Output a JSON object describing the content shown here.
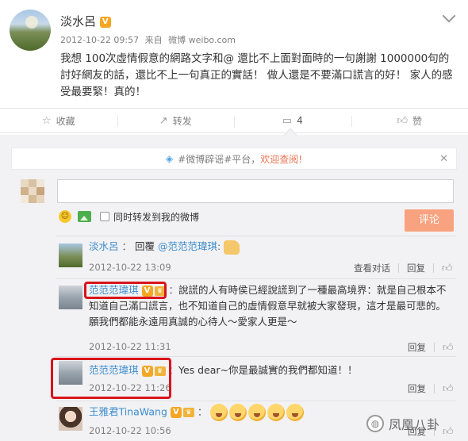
{
  "post": {
    "author": "淡水呂",
    "verified_badge": "V",
    "timestamp": "2012-10-22 09:57",
    "source_prefix": "来自",
    "source": "微博 weibo.com",
    "text": "我想 100次虛情假意的網路文字和@ 還比不上面對面時的一句謝謝 1000000句的討好網友的話，還比不上一句真正的實話！ 做人還是不要滿口謊言的好！ 家人的感受最要緊！真的！"
  },
  "actions": {
    "favorite": "收藏",
    "repost": "转发",
    "comment_count": "4",
    "like": "赞"
  },
  "comment_box": {
    "rumor_notice": "#微博辟谣#平台，",
    "rumor_link": "欢迎查阅!",
    "input_value": "",
    "repost_option": "同时转发到我的微博",
    "submit_label": "评论"
  },
  "comments": [
    {
      "author": "淡水呂",
      "reply_prefix": "回覆",
      "mention": "@范范范瑋琪",
      "text": "",
      "time": "2012-10-22 13:09",
      "view_thread": "查看对话",
      "reply": "回复"
    },
    {
      "author": "范范范瑋琪",
      "text_lead": "說謊的人有時侯已經說謊到了一種最高境界：就是自己根本不知道自己滿口謊言，也不知道自己的虛情假意早就被大家發現，這才是最可悲的。願我們都能永遠用真誠的心待人～愛家人更是～",
      "time": "2012-10-22 11:31",
      "reply": "回复"
    },
    {
      "author": "范范范瑋琪",
      "text": "Yes dear~你是最誠實的我們都知道！！",
      "time": "2012-10-22 11:26",
      "reply": "回复"
    },
    {
      "author": "王雅君TinaWang",
      "text": "",
      "time": "2012-10-22 10:56",
      "reply": "回复"
    }
  ],
  "watermark": "凤凰八卦",
  "icons": {
    "favorite": "star-icon",
    "repost": "share-icon",
    "comment": "comment-icon",
    "like": "thumb-up-icon",
    "rumor": "shield-icon",
    "close": "close-icon",
    "chevron": "chevron-down-icon"
  },
  "colors": {
    "link": "#eb7350",
    "submit": "#f8a27f",
    "highlight": "#d9141b",
    "verified": "#f5a623"
  }
}
